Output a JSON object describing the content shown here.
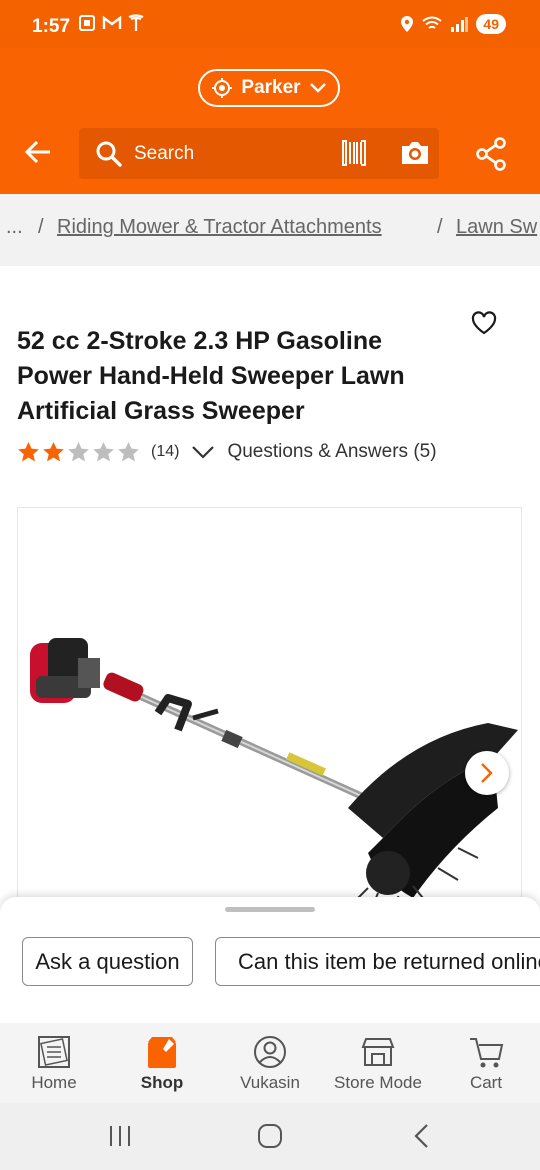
{
  "status_bar": {
    "time": "1:57",
    "battery": "49"
  },
  "header": {
    "store_name": "Parker",
    "search_placeholder": "Search"
  },
  "breadcrumb": {
    "ellipsis": "...",
    "separator": "/",
    "items": [
      "Riding Mower & Tractor Attachments",
      "Lawn Sw"
    ]
  },
  "product": {
    "title": "52 cc 2-Stroke 2.3 HP Gasoline Power Hand-Held Sweeper Lawn Artificial Grass Sweeper",
    "rating": 2,
    "rating_max": 5,
    "review_count": "(14)",
    "qa_label": "Questions & Answers (5)"
  },
  "colors": {
    "brand_orange": "#f96302",
    "star_filled": "#f96302",
    "star_empty": "#bdbdbd"
  },
  "bottom_sheet": {
    "ask_question": "Ask a question",
    "returned_question": "Can this item be returned online?"
  },
  "tabbar": {
    "tabs": [
      {
        "label": "Home",
        "icon": "home-depot-logo-icon"
      },
      {
        "label": "Shop",
        "icon": "shop-icon"
      },
      {
        "label": "Vukasin",
        "icon": "account-icon"
      },
      {
        "label": "Store Mode",
        "icon": "store-icon"
      },
      {
        "label": "Cart",
        "icon": "cart-icon"
      }
    ],
    "active": "Shop"
  }
}
